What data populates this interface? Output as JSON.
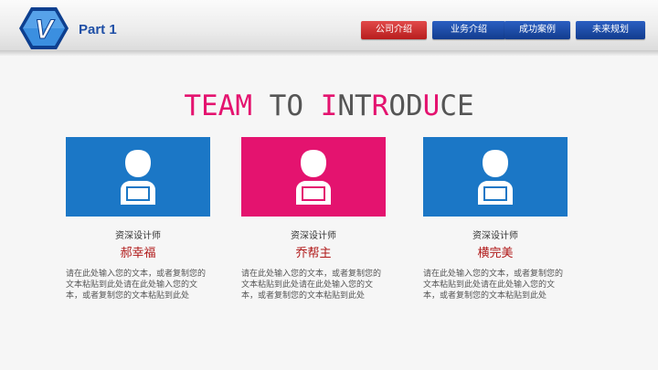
{
  "header": {
    "part_label": "Part 1",
    "logo_letter": "V",
    "nav": [
      {
        "label": "公司介绍",
        "active": true
      },
      {
        "label": "业务介绍",
        "active": false
      },
      {
        "label": "成功案例",
        "active": false
      },
      {
        "label": "未来规划",
        "active": false
      }
    ]
  },
  "headline": {
    "segments": [
      {
        "text": "TEAM",
        "accent": true
      },
      {
        "text": " TO ",
        "accent": false
      },
      {
        "text": "I",
        "accent": true
      },
      {
        "text": "NT",
        "accent": false
      },
      {
        "text": "R",
        "accent": true
      },
      {
        "text": "OD",
        "accent": false
      },
      {
        "text": "U",
        "accent": true
      },
      {
        "text": "CE",
        "accent": false
      }
    ]
  },
  "members": [
    {
      "icon": "user-laptop-icon",
      "card_color": "#1b77c6",
      "role": "资深设计师",
      "name": "郝幸福",
      "desc": "请在此处输入您的文本，或者复制您的文本粘贴到此处请在此处输入您的文本，或者复制您的文本粘贴到此处"
    },
    {
      "icon": "user-laptop-icon",
      "card_color": "#e4136f",
      "role": "资深设计师",
      "name": "乔帮主",
      "desc": "请在此处输入您的文本，或者复制您的文本粘贴到此处请在此处输入您的文本，或者复制您的文本粘贴到此处"
    },
    {
      "icon": "user-laptop-icon",
      "card_color": "#1b77c6",
      "role": "资深设计师",
      "name": "横完美",
      "desc": "请在此处输入您的文本，或者复制您的文本粘贴到此处请在此处输入您的文本，或者复制您的文本粘贴到此处"
    }
  ],
  "colors": {
    "accent_pink": "#e4136f",
    "brand_blue": "#1b77c6",
    "nav_active": "#c62828",
    "name_red": "#b01818"
  }
}
